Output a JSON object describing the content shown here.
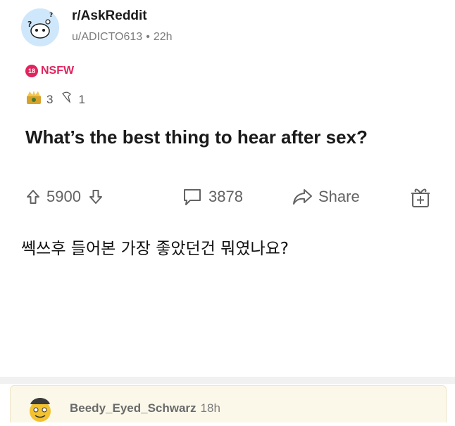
{
  "post": {
    "subreddit": "r/AskReddit",
    "author": "u/ADICTO613",
    "separator": "•",
    "age": "22h",
    "nsfw_label": "NSFW",
    "nsfw_badge": "18",
    "awards": [
      {
        "icon": "gold-award-icon",
        "count": "3"
      },
      {
        "icon": "silver-award-icon",
        "count": "1"
      }
    ],
    "title": "What’s the best thing to hear after sex?"
  },
  "actions": {
    "upvotes": "5900",
    "comments": "3878",
    "share_label": "Share"
  },
  "korean_caption": "쎅쓰후 들어본 가장 좋았던건 뭐였나요?",
  "comment": {
    "user": "Beedy_Eyed_Schwarz",
    "age": "18h"
  },
  "colors": {
    "nsfw": "#e0245e",
    "subreddit_avatar_bg": "#cfe7fb",
    "comment_highlight_bg": "#fbf8ea"
  }
}
